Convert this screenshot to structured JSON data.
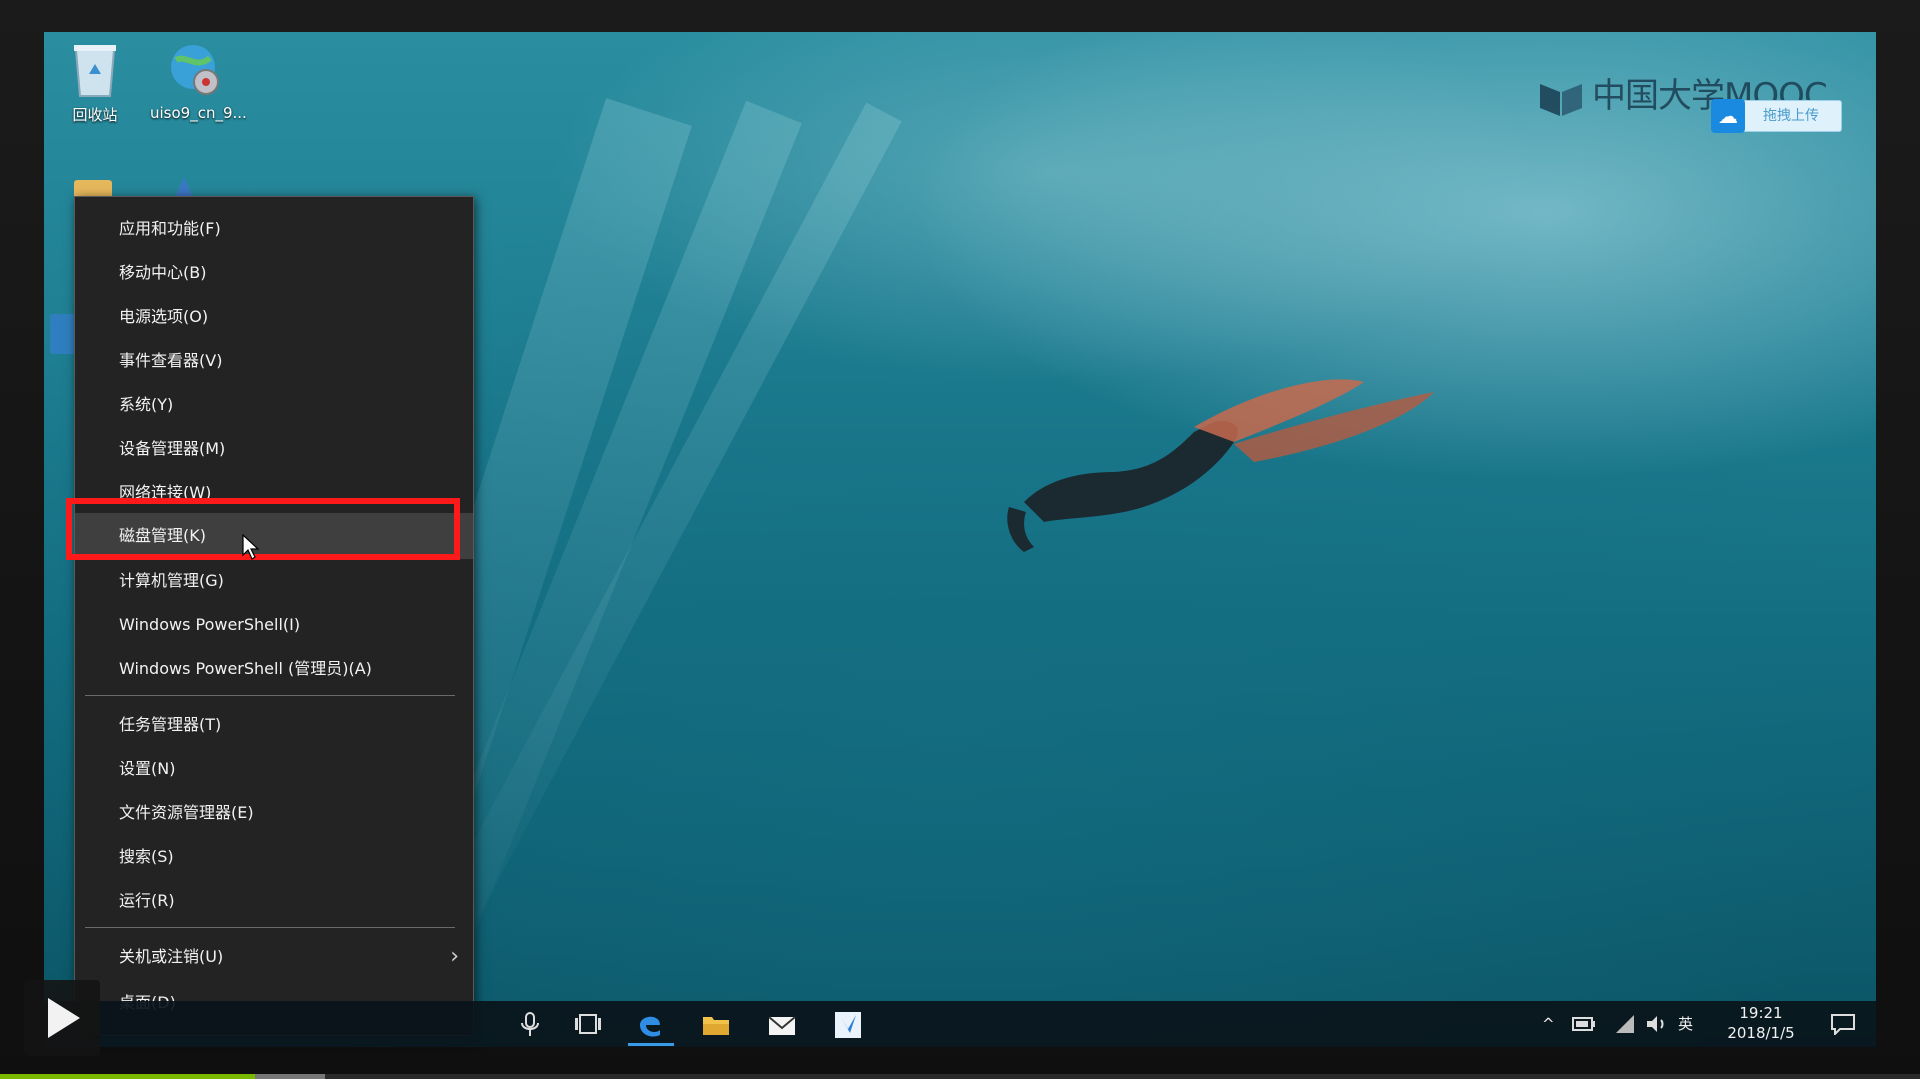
{
  "desktop": {
    "icons": [
      {
        "label": "回收站",
        "icon": "recycle-bin-icon"
      },
      {
        "label": "uiso9_cn_9...",
        "icon": "ultraiso-icon"
      }
    ]
  },
  "watermark": {
    "brand": "中国大学MOOC",
    "upload_label": "拖拽上传"
  },
  "context_menu": {
    "items": [
      {
        "label": "应用和功能(F)"
      },
      {
        "label": "移动中心(B)"
      },
      {
        "label": "电源选项(O)"
      },
      {
        "label": "事件查看器(V)"
      },
      {
        "label": "系统(Y)"
      },
      {
        "label": "设备管理器(M)"
      },
      {
        "label": "网络连接(W)"
      },
      {
        "label": "磁盘管理(K)"
      },
      {
        "label": "计算机管理(G)"
      },
      {
        "label": "Windows PowerShell(I)"
      },
      {
        "label": "Windows PowerShell (管理员)(A)"
      },
      {
        "label": "任务管理器(T)"
      },
      {
        "label": "设置(N)"
      },
      {
        "label": "文件资源管理器(E)"
      },
      {
        "label": "搜索(S)"
      },
      {
        "label": "运行(R)"
      },
      {
        "label": "关机或注销(U)"
      },
      {
        "label": "桌面(D)"
      }
    ],
    "highlighted": "磁盘管理(K)"
  },
  "taskbar": {
    "apps": [
      "microphone-icon",
      "task-view-icon",
      "edge-icon",
      "file-explorer-icon",
      "mail-icon",
      "store-icon"
    ],
    "tray": {
      "ime": "英",
      "time": "19:21",
      "date": "2018/1/5"
    }
  },
  "player": {
    "progress_fraction": 0.133
  }
}
